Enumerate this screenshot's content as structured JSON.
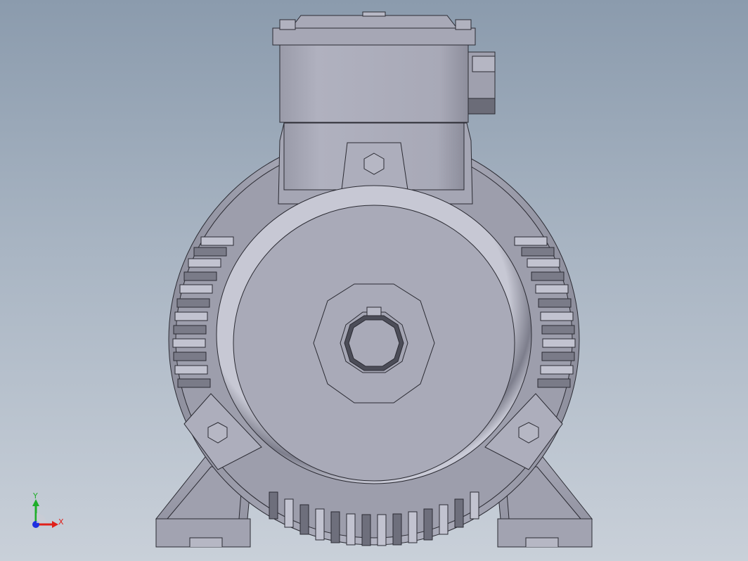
{
  "viewport": {
    "background_top": "#8b9bad",
    "background_bottom": "#c9d0d9"
  },
  "triad": {
    "x_label": "X",
    "y_label": "Y",
    "x_color": "#e0201a",
    "y_color": "#1fae2a",
    "z_color": "#1e2fe0"
  },
  "model": {
    "icon": "electric-motor-front-view",
    "body_color": "#a9aab8",
    "edge_color": "#2b2b33"
  }
}
